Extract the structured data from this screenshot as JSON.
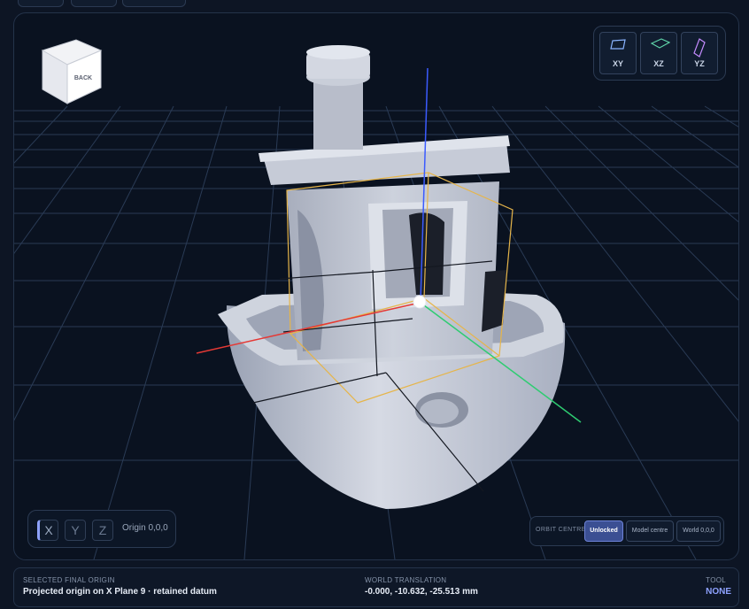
{
  "colors": {
    "accent": "#8ea2ff",
    "axis_x": "#e53935",
    "axis_y": "#2ecc71",
    "axis_z": "#3b5bff",
    "bounding_box": "#e6b54a",
    "model": "#c5cad6",
    "tool_value": "#8ea2ff"
  },
  "viewcube": {
    "face_label": "BACK",
    "icon": "view-cube"
  },
  "plane_buttons": [
    {
      "label": "XY",
      "icon": "plane-xy-icon",
      "color": "#8ab4ff"
    },
    {
      "label": "XZ",
      "icon": "plane-xz-icon",
      "color": "#5fd3a8"
    },
    {
      "label": "YZ",
      "icon": "plane-yz-icon",
      "color": "#c58cff"
    }
  ],
  "axis_selector": {
    "axes": [
      "X",
      "Y",
      "Z"
    ],
    "active": "X",
    "origin_label": "Origin 0,0,0"
  },
  "orbit_centre": {
    "title": "ORBIT CENTRE",
    "options": [
      "Unlocked",
      "Model centre",
      "World 0,0,0"
    ],
    "selected": "Unlocked"
  },
  "status": {
    "selected_origin_label": "SELECTED FINAL ORIGIN",
    "selected_origin_value": "Projected origin on X Plane 9 · retained datum",
    "world_translation_label": "WORLD TRANSLATION",
    "world_translation_value": "-0.000, -10.632, -25.513 mm",
    "tool_label": "TOOL",
    "tool_value": "NONE"
  }
}
